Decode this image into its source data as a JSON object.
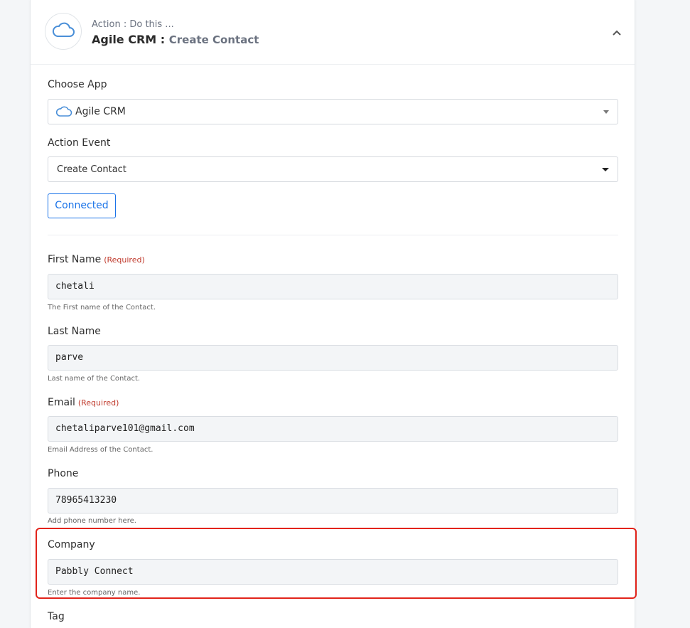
{
  "header": {
    "subtitle": "Action : Do this ...",
    "app_name": "Agile CRM :",
    "event_name": "Create Contact",
    "collapse_icon": "chevron-up-icon",
    "app_icon": "cloud-icon"
  },
  "choose_app": {
    "label": "Choose App",
    "value": "Agile CRM",
    "icon": "cloud-icon"
  },
  "action_event": {
    "label": "Action Event",
    "value": "Create Contact"
  },
  "connected_button": "Connected",
  "fields": {
    "first_name": {
      "label": "First Name",
      "required": "(Required)",
      "value": "chetali",
      "help": "The First name of the Contact."
    },
    "last_name": {
      "label": "Last Name",
      "value": "parve",
      "help": "Last name of the Contact."
    },
    "email": {
      "label": "Email",
      "required": "(Required)",
      "value": "chetaliparve101@gmail.com",
      "help": "Email Address of the Contact."
    },
    "phone": {
      "label": "Phone",
      "value": "78965413230",
      "help": "Add phone number here."
    },
    "company": {
      "label": "Company",
      "value": "Pabbly Connect",
      "help": "Enter the company name."
    },
    "tag": {
      "label": "Tag"
    }
  },
  "colors": {
    "accent": "#1a73e8",
    "required": "#c0392b",
    "highlight": "#e2231a",
    "cloud": "#4a8fd8"
  }
}
